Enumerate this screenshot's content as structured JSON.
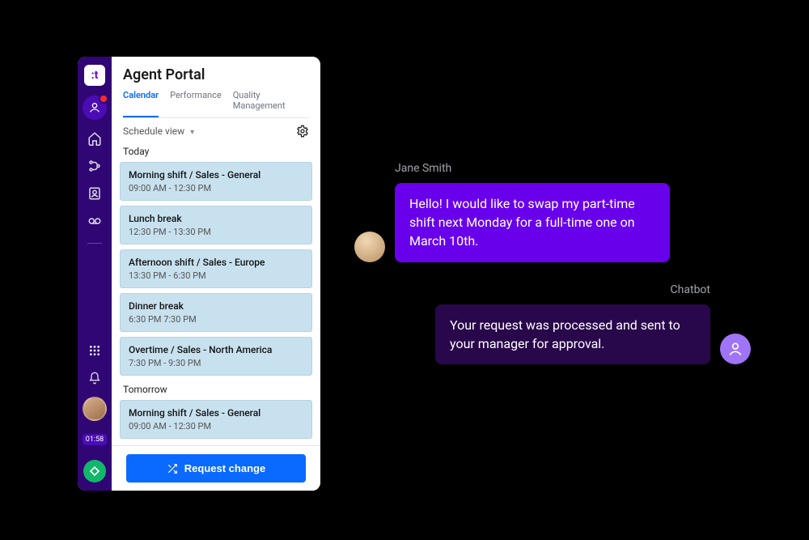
{
  "app": {
    "logo_letter": ":t",
    "title": "Agent Portal",
    "tabs": [
      {
        "id": "calendar",
        "label": "Calendar",
        "active": true
      },
      {
        "id": "performance",
        "label": "Performance",
        "active": false
      },
      {
        "id": "quality",
        "label": "Quality Management",
        "active": false
      }
    ],
    "view_selector": "Schedule view",
    "settings_icon": "gear-icon",
    "sections": [
      {
        "label": "Today",
        "items": [
          {
            "title": "Morning shift / Sales - General",
            "range": "09:00 AM - 12:30 PM"
          },
          {
            "title": "Lunch break",
            "range": "12:30 PM - 13:30 PM"
          },
          {
            "title": "Afternoon shift / Sales - Europe",
            "range": "13:30 PM - 6:30 PM"
          },
          {
            "title": "Dinner break",
            "range": "6:30 PM 7:30 PM"
          },
          {
            "title": "Overtime / Sales - North America",
            "range": "7:30 PM - 9:30 PM"
          }
        ]
      },
      {
        "label": "Tomorrow",
        "items": [
          {
            "title": "Morning shift / Sales - General",
            "range": "09:00 AM - 12:30 PM"
          }
        ]
      }
    ],
    "request_button": "Request change",
    "rail_time": "01:58"
  },
  "chat": {
    "user_name": "Jane Smith",
    "user_message": "Hello! I would like to swap my part-time shift next Monday for a full-time one on March 10th.",
    "bot_name": "Chatbot",
    "bot_reply": "Your request was processed and sent to your manager for approval."
  }
}
